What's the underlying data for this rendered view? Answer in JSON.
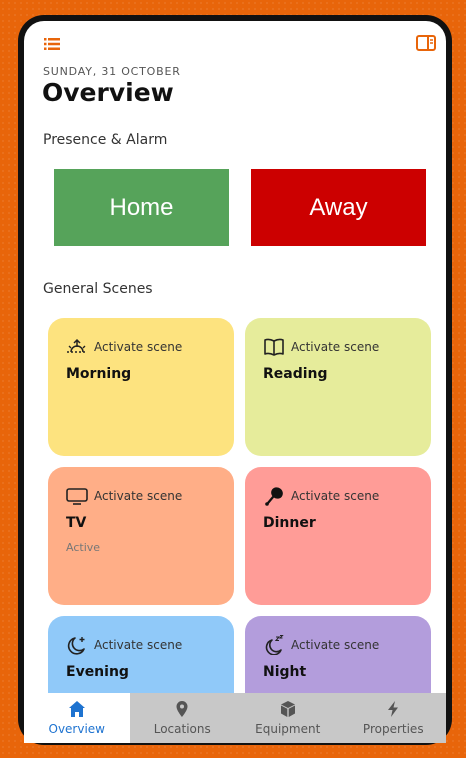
{
  "colors": {
    "accent": "#e8650a",
    "home": "#56a35a",
    "away": "#cc0000",
    "tab_active": "#1e73d0"
  },
  "header": {
    "date": "SUNDAY, 31 OCTOBER",
    "title": "Overview"
  },
  "presence": {
    "section_title": "Presence & Alarm",
    "home_label": "Home",
    "away_label": "Away"
  },
  "scenes": {
    "section_title": "General Scenes",
    "items": [
      {
        "icon": "sunrise-icon",
        "action": "Activate scene",
        "name": "Morning",
        "status": "",
        "color": "#fde37f"
      },
      {
        "icon": "book-icon",
        "action": "Activate scene",
        "name": "Reading",
        "status": "",
        "color": "#e6ec9b"
      },
      {
        "icon": "tv-icon",
        "action": "Activate scene",
        "name": "TV",
        "status": "Active",
        "color": "#ffae87"
      },
      {
        "icon": "drumstick-icon",
        "action": "Activate scene",
        "name": "Dinner",
        "status": "",
        "color": "#ff9c97"
      },
      {
        "icon": "moon-star-icon",
        "action": "Activate scene",
        "name": "Evening",
        "status": "",
        "color": "#90c9f9"
      },
      {
        "icon": "moon-sleep-icon",
        "action": "Activate scene",
        "name": "Night",
        "status": "",
        "color": "#b39ddc"
      }
    ]
  },
  "tabs": [
    {
      "label": "Overview",
      "icon": "home-icon",
      "active": true
    },
    {
      "label": "Locations",
      "icon": "map-pin-icon",
      "active": false
    },
    {
      "label": "Equipment",
      "icon": "cube-icon",
      "active": false
    },
    {
      "label": "Properties",
      "icon": "lightning-icon",
      "active": false
    }
  ]
}
